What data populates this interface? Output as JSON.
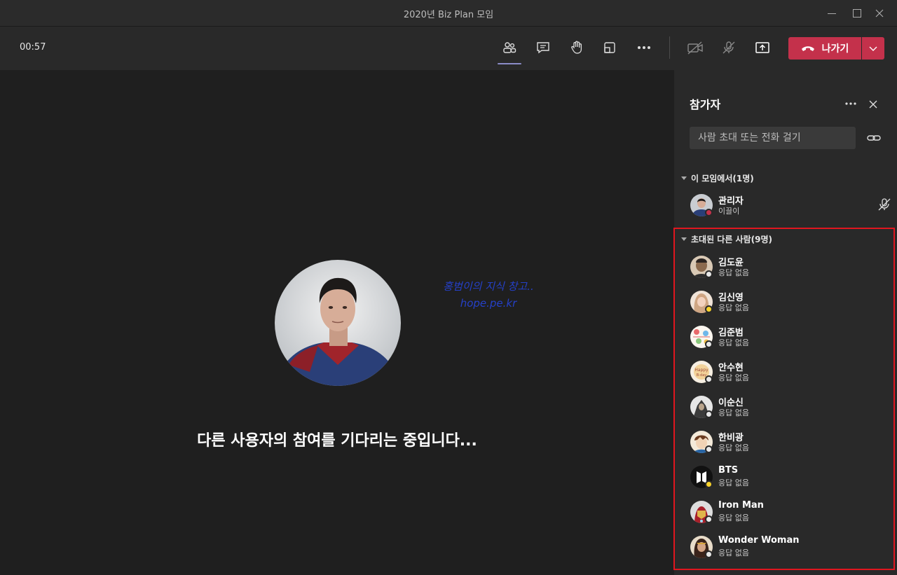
{
  "window": {
    "title": "2020년 Biz Plan 모임"
  },
  "toolbar": {
    "timer": "00:57",
    "buttons": [
      "participants-icon",
      "chat-icon",
      "raise-hand-icon",
      "share-tray-icon",
      "more-icon",
      "camera-off-icon",
      "mic-off-icon",
      "share-screen-icon"
    ],
    "leave_label": "나가기",
    "leave_color": "#c4314b"
  },
  "stage": {
    "watermark_line1": "홍범이의 지식 창고..",
    "watermark_line2": "hope.pe.kr",
    "waiting_message": "다른 사용자의 참여를 기다리는 중입니다..."
  },
  "panel": {
    "title": "참가자",
    "invite_placeholder": "사람 초대 또는 전화 걸기",
    "in_meeting": {
      "header": "이 모임에서(1명)",
      "people": [
        {
          "name": "관리자",
          "sub": "이끌이",
          "status": "busy"
        }
      ]
    },
    "invited": {
      "header": "초대된 다른 사람(9명)",
      "people": [
        {
          "name": "김도윤",
          "sub": "응답 없음",
          "status": "offline"
        },
        {
          "name": "김신영",
          "sub": "응답 없음",
          "status": "away"
        },
        {
          "name": "김준범",
          "sub": "응답 없음",
          "status": "offline"
        },
        {
          "name": "안수현",
          "sub": "응답 없음",
          "status": "offline"
        },
        {
          "name": "이순신",
          "sub": "응답 없음",
          "status": "offline"
        },
        {
          "name": "한비광",
          "sub": "응답 없음",
          "status": "offline"
        },
        {
          "name": "BTS",
          "sub": "응답 없음",
          "status": "away"
        },
        {
          "name": "Iron Man",
          "sub": "응답 없음",
          "status": "offline"
        },
        {
          "name": "Wonder Woman",
          "sub": "응답 없음",
          "status": "offline"
        }
      ]
    }
  },
  "colors": {
    "highlight": "#e0161f",
    "accent": "#8b8cc7"
  }
}
